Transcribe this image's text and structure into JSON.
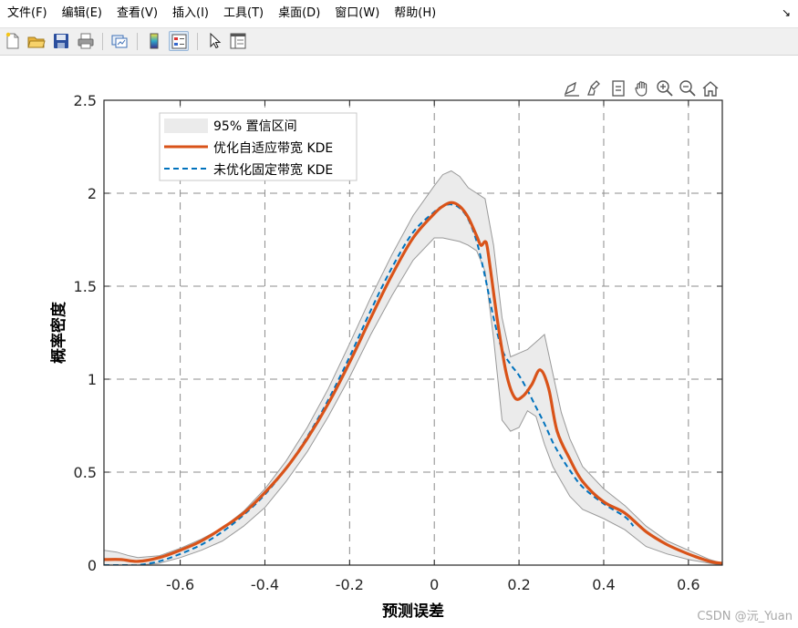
{
  "menu": {
    "items": [
      "文件(F)",
      "编辑(E)",
      "查看(V)",
      "插入(I)",
      "工具(T)",
      "桌面(D)",
      "窗口(W)",
      "帮助(H)"
    ],
    "overflow_arrow": "↘"
  },
  "toolbar": {
    "buttons": [
      "new-figure-icon",
      "open-file-icon",
      "save-icon",
      "print-icon",
      "link-plot-icon",
      "insert-colorbar-icon",
      "insert-legend-icon",
      "select-arrow-icon",
      "property-inspector-icon"
    ]
  },
  "axes_toolbar": {
    "buttons": [
      "data-tips-icon",
      "brush-icon",
      "export-icon",
      "pan-icon",
      "zoom-in-icon",
      "zoom-out-icon",
      "home-icon"
    ]
  },
  "watermark": "CSDN @沅_Yuan",
  "colors": {
    "adaptive": "#d95319",
    "fixed": "#0072bd",
    "band_fill": "#ebebeb",
    "band_edge": "#999999"
  },
  "chart_data": {
    "type": "line",
    "title": "",
    "xlabel": "预测误差",
    "ylabel": "概率密度",
    "xlim": [
      -0.78,
      0.68
    ],
    "ylim": [
      0,
      2.5
    ],
    "xticks": [
      -0.6,
      -0.4,
      -0.2,
      0,
      0.2,
      0.4,
      0.6
    ],
    "xtick_labels": [
      "-0.6",
      "-0.4",
      "-0.2",
      "0",
      "0.2",
      "0.4",
      "0.6"
    ],
    "yticks": [
      0,
      0.5,
      1,
      1.5,
      2,
      2.5
    ],
    "ytick_labels": [
      "0",
      "0.5",
      "1",
      "1.5",
      "2",
      "2.5"
    ],
    "grid": true,
    "grid_style": "dashed",
    "legend_position": "top-left",
    "legend": [
      "95% 置信区间",
      "优化自适应带宽 KDE",
      "未优化固定带宽 KDE"
    ],
    "band": {
      "name": "95% 置信区间",
      "x": [
        -0.78,
        -0.75,
        -0.72,
        -0.7,
        -0.65,
        -0.6,
        -0.55,
        -0.5,
        -0.45,
        -0.4,
        -0.35,
        -0.3,
        -0.25,
        -0.2,
        -0.15,
        -0.1,
        -0.05,
        0,
        0.02,
        0.04,
        0.06,
        0.08,
        0.1,
        0.12,
        0.14,
        0.16,
        0.18,
        0.2,
        0.22,
        0.24,
        0.26,
        0.28,
        0.3,
        0.32,
        0.35,
        0.4,
        0.45,
        0.5,
        0.55,
        0.6,
        0.65,
        0.68
      ],
      "upper": [
        0.08,
        0.07,
        0.05,
        0.04,
        0.05,
        0.09,
        0.14,
        0.2,
        0.29,
        0.41,
        0.56,
        0.74,
        0.95,
        1.19,
        1.44,
        1.67,
        1.88,
        2.04,
        2.1,
        2.12,
        2.09,
        2.03,
        2.0,
        1.97,
        1.72,
        1.33,
        1.12,
        1.14,
        1.16,
        1.2,
        1.24,
        1.03,
        0.82,
        0.68,
        0.53,
        0.41,
        0.32,
        0.21,
        0.13,
        0.08,
        0.03,
        0.01
      ],
      "lower": [
        0.0,
        0.0,
        0.0,
        0.0,
        0.01,
        0.04,
        0.08,
        0.13,
        0.21,
        0.31,
        0.45,
        0.61,
        0.8,
        1.01,
        1.24,
        1.45,
        1.64,
        1.76,
        1.76,
        1.75,
        1.74,
        1.72,
        1.69,
        1.58,
        1.22,
        0.78,
        0.72,
        0.74,
        0.83,
        0.8,
        0.65,
        0.53,
        0.45,
        0.37,
        0.3,
        0.25,
        0.19,
        0.1,
        0.06,
        0.03,
        0.01,
        0.0
      ]
    },
    "series": [
      {
        "name": "优化自适应带宽 KDE",
        "style": "solid",
        "x": [
          -0.78,
          -0.74,
          -0.7,
          -0.65,
          -0.6,
          -0.55,
          -0.5,
          -0.45,
          -0.4,
          -0.35,
          -0.3,
          -0.25,
          -0.2,
          -0.15,
          -0.1,
          -0.05,
          0,
          0.02,
          0.04,
          0.06,
          0.08,
          0.1,
          0.11,
          0.12,
          0.125,
          0.135,
          0.15,
          0.17,
          0.19,
          0.21,
          0.23,
          0.25,
          0.27,
          0.29,
          0.32,
          0.35,
          0.4,
          0.45,
          0.5,
          0.55,
          0.6,
          0.65,
          0.68
        ],
        "values": [
          0.03,
          0.03,
          0.02,
          0.04,
          0.08,
          0.13,
          0.2,
          0.28,
          0.39,
          0.52,
          0.68,
          0.87,
          1.09,
          1.33,
          1.56,
          1.76,
          1.89,
          1.93,
          1.95,
          1.93,
          1.87,
          1.77,
          1.72,
          1.74,
          1.71,
          1.55,
          1.3,
          1.03,
          0.9,
          0.91,
          0.97,
          1.05,
          0.95,
          0.72,
          0.57,
          0.45,
          0.34,
          0.28,
          0.18,
          0.11,
          0.06,
          0.02,
          0.01
        ]
      },
      {
        "name": "未优化固定带宽 KDE",
        "style": "dashed",
        "x": [
          -0.78,
          -0.75,
          -0.72,
          -0.7,
          -0.65,
          -0.6,
          -0.55,
          -0.5,
          -0.45,
          -0.4,
          -0.35,
          -0.3,
          -0.25,
          -0.2,
          -0.15,
          -0.1,
          -0.05,
          0,
          0.02,
          0.04,
          0.06,
          0.08,
          0.1,
          0.12,
          0.14,
          0.16,
          0.18,
          0.2,
          0.22,
          0.24,
          0.26,
          0.28,
          0.3,
          0.32,
          0.35,
          0.4,
          0.45,
          0.47
        ],
        "values": [
          0.0,
          0.0,
          0.0,
          0.0,
          0.02,
          0.06,
          0.11,
          0.18,
          0.27,
          0.38,
          0.52,
          0.69,
          0.89,
          1.12,
          1.37,
          1.6,
          1.79,
          1.9,
          1.93,
          1.94,
          1.92,
          1.86,
          1.74,
          1.55,
          1.33,
          1.16,
          1.08,
          1.02,
          0.94,
          0.85,
          0.76,
          0.66,
          0.58,
          0.51,
          0.42,
          0.33,
          0.26,
          0.21
        ]
      }
    ]
  }
}
